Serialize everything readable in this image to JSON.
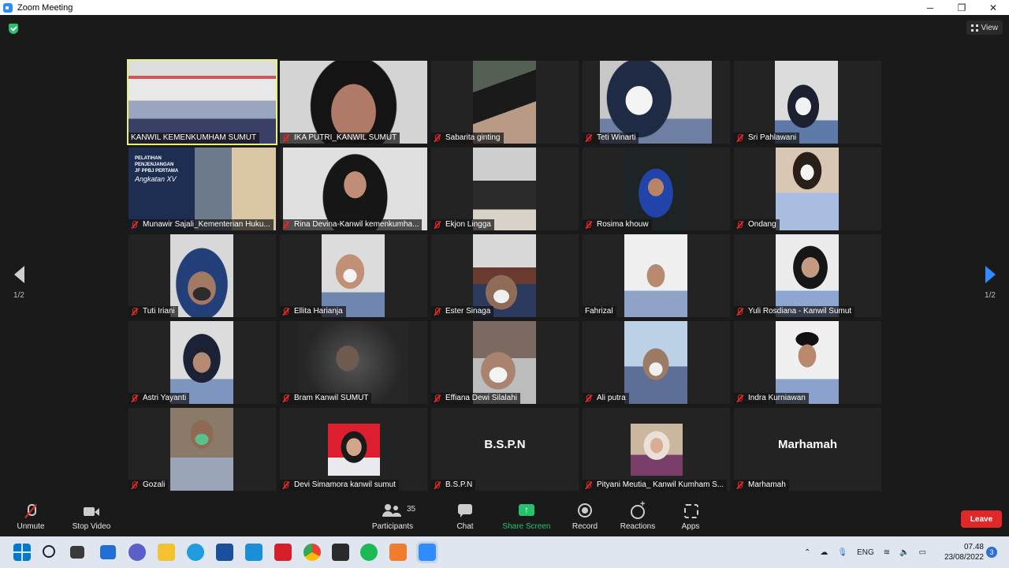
{
  "window": {
    "title": "Zoom Meeting",
    "minimize_glyph": "─",
    "maximize_glyph": "❐",
    "close_glyph": "✕"
  },
  "stage": {
    "view_label": "View",
    "page_left": "1/2",
    "page_right": "1/2"
  },
  "participants": [
    {
      "name": "KANWIL KEMENKUMHAM SUMUT",
      "muted": false
    },
    {
      "name": "IKA PUTRI_KANWIL SUMUT",
      "muted": true
    },
    {
      "name": "Sabarita ginting",
      "muted": true
    },
    {
      "name": "Teti Winarti",
      "muted": true
    },
    {
      "name": "Sri Pahlawani",
      "muted": true
    },
    {
      "name": "Munawir Sajali_Kementerian Huku...",
      "muted": true
    },
    {
      "name": "Rina Devina-Kanwil kemenkumha...",
      "muted": true
    },
    {
      "name": "Ekjon Lingga",
      "muted": true
    },
    {
      "name": "Rosima khouw",
      "muted": true
    },
    {
      "name": "Ondang",
      "muted": true
    },
    {
      "name": "Tuti Iriani",
      "muted": true
    },
    {
      "name": "Ellita Harianja",
      "muted": true
    },
    {
      "name": "Ester Sinaga",
      "muted": true
    },
    {
      "name": "Fahrizal",
      "muted": false
    },
    {
      "name": "Yuli Rosdiana - Kanwil Sumut",
      "muted": true
    },
    {
      "name": "Astri Yayanti",
      "muted": true
    },
    {
      "name": "Bram Kanwil SUMUT",
      "muted": true
    },
    {
      "name": "Effiana Dewi Silalahi",
      "muted": true
    },
    {
      "name": "Ali putra",
      "muted": true
    },
    {
      "name": "Indra Kurniawan",
      "muted": true
    },
    {
      "name": "Gozali",
      "muted": true
    },
    {
      "name": "Devi Simamora kanwil sumut",
      "muted": true
    },
    {
      "name": "B.S.P.N",
      "muted": true
    },
    {
      "name": "Pityani Meutia_ Kanwil Kumham S...",
      "muted": true
    },
    {
      "name": "Marhamah",
      "muted": true
    }
  ],
  "no_video_names": {
    "bspn": "B.S.P.N",
    "marhamah": "Marhamah"
  },
  "slide_text": {
    "line1": "PELATIHAN",
    "line2": "PENJENJANGAN",
    "line3": "JF PPBJ PERTAMA",
    "line4": "Angkatan XV"
  },
  "toolbar": {
    "unmute": "Unmute",
    "stop_video": "Stop Video",
    "participants": "Participants",
    "participants_count": "35",
    "chat": "Chat",
    "share_screen": "Share Screen",
    "record": "Record",
    "reactions": "Reactions",
    "apps": "Apps",
    "leave": "Leave"
  },
  "taskbar": {
    "language": "ENG",
    "time": "07.48",
    "date": "23/08/2022",
    "notifications": "3"
  },
  "colors": {
    "accent_blue": "#2d8cff",
    "share_green": "#23c36b",
    "leave_red": "#e02828",
    "active_speaker": "#e7f07a"
  }
}
